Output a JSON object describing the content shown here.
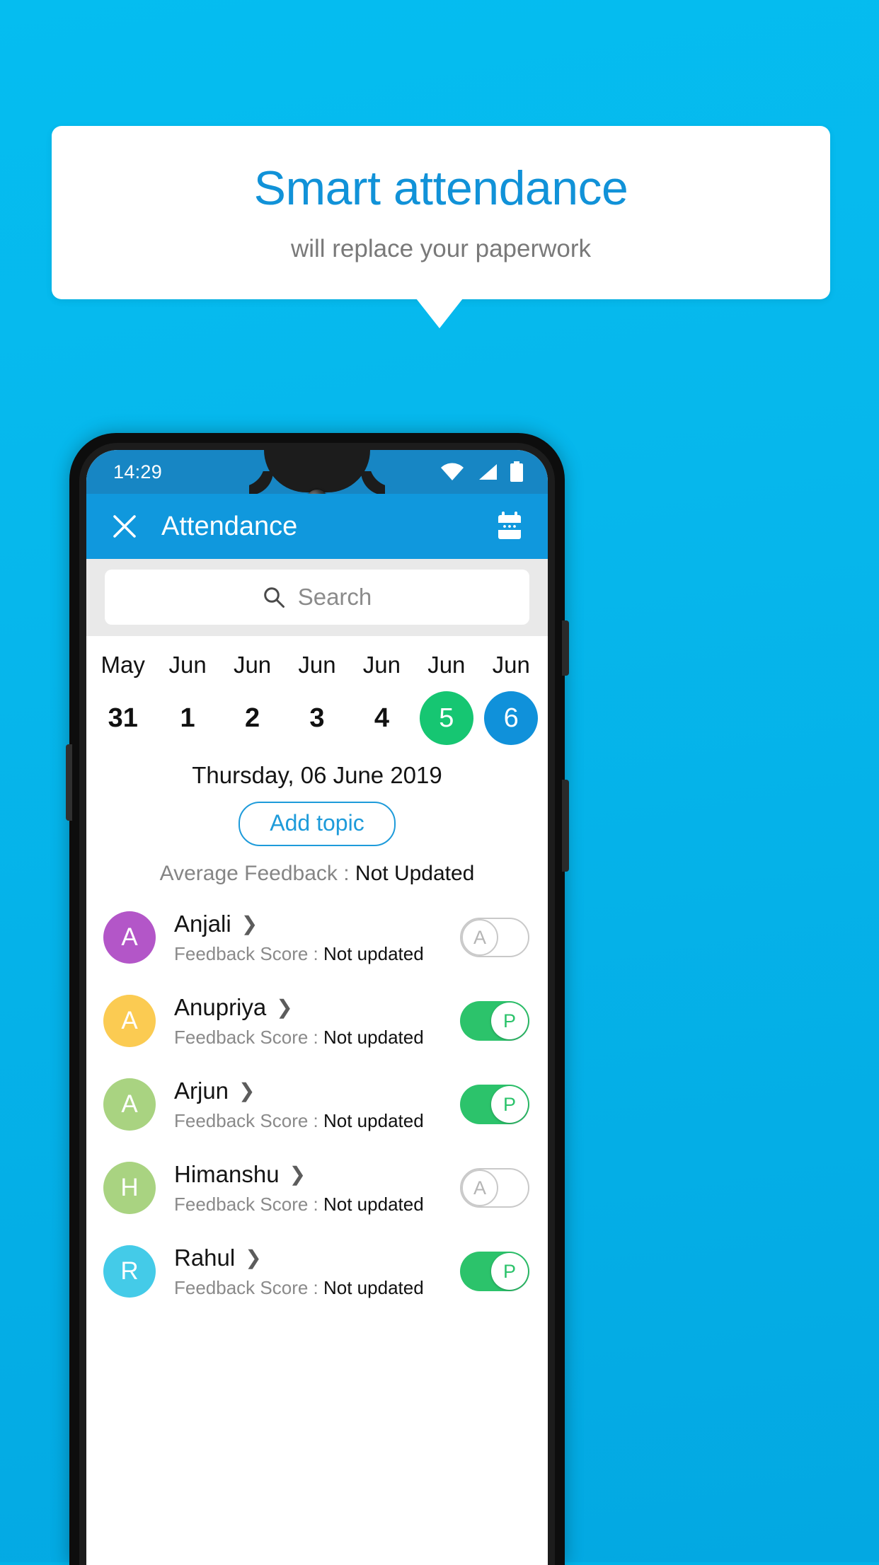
{
  "promo": {
    "title": "Smart attendance",
    "subtitle": "will replace your paperwork",
    "title_color": "#1192D8",
    "background_color": "#05BDF0"
  },
  "phone": {
    "status_bar": {
      "time": "14:29",
      "icons": [
        "wifi-icon",
        "signal-icon",
        "battery-icon"
      ],
      "background_color": "#1786C4"
    },
    "app_bar": {
      "close_icon": "close-icon",
      "title": "Attendance",
      "calendar_icon": "calendar-icon",
      "background_color": "#1098DD"
    },
    "search": {
      "icon": "search-icon",
      "placeholder": "Search"
    },
    "date_strip": [
      {
        "month": "May",
        "day": "31",
        "selected": "none"
      },
      {
        "month": "Jun",
        "day": "1",
        "selected": "none"
      },
      {
        "month": "Jun",
        "day": "2",
        "selected": "none"
      },
      {
        "month": "Jun",
        "day": "3",
        "selected": "none"
      },
      {
        "month": "Jun",
        "day": "4",
        "selected": "none"
      },
      {
        "month": "Jun",
        "day": "5",
        "selected": "green"
      },
      {
        "month": "Jun",
        "day": "6",
        "selected": "blue"
      }
    ],
    "selected_date": "Thursday, 06 June 2019",
    "add_topic_label": "Add topic",
    "average_feedback": {
      "label": "Average Feedback : ",
      "value": "Not Updated"
    },
    "students": [
      {
        "initial": "A",
        "name": "Anjali",
        "avatar_color": "#B356C8",
        "feedback_label": "Feedback Score : ",
        "feedback_value": "Not updated",
        "attendance": "A",
        "toggle_state": "off"
      },
      {
        "initial": "A",
        "name": "Anupriya",
        "avatar_color": "#FBCB52",
        "feedback_label": "Feedback Score : ",
        "feedback_value": "Not updated",
        "attendance": "P",
        "toggle_state": "on"
      },
      {
        "initial": "A",
        "name": "Arjun",
        "avatar_color": "#A9D381",
        "feedback_label": "Feedback Score : ",
        "feedback_value": "Not updated",
        "attendance": "P",
        "toggle_state": "on"
      },
      {
        "initial": "H",
        "name": "Himanshu",
        "avatar_color": "#A9D381",
        "feedback_label": "Feedback Score : ",
        "feedback_value": "Not updated",
        "attendance": "A",
        "toggle_state": "off"
      },
      {
        "initial": "R",
        "name": "Rahul",
        "avatar_color": "#44CBE8",
        "feedback_label": "Feedback Score : ",
        "feedback_value": "Not updated",
        "attendance": "P",
        "toggle_state": "on"
      }
    ],
    "colors": {
      "green_toggle": "#2CC36B",
      "selected_day_green": "#16C672",
      "selected_day_blue": "#1091DA",
      "accent_blue": "#1E9BDA"
    }
  }
}
